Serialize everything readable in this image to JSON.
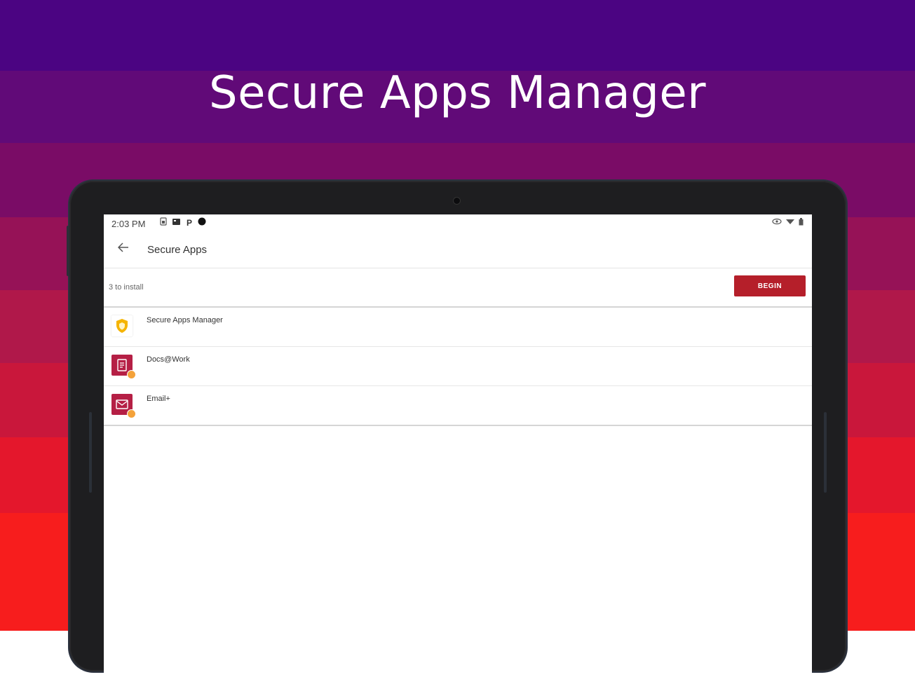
{
  "headline": "Secure Apps Manager",
  "colors": {
    "bands": [
      "#4b0482",
      "#610a78",
      "#7a0c66",
      "#961257",
      "#b0184a",
      "#c9173b",
      "#e4172c",
      "#f71d1d",
      "#fb1a18"
    ],
    "accent": "#b51f2a"
  },
  "status_bar": {
    "time": "2:03 PM",
    "left_icons": [
      "sim-icon",
      "app-notification-icon",
      "parking-icon",
      "record-dot-icon"
    ],
    "p_glyph": "P",
    "right_icons": [
      "eye-icon",
      "wifi-icon",
      "battery-icon"
    ]
  },
  "app_bar": {
    "back_icon": "back-arrow-icon",
    "title": "Secure Apps"
  },
  "install_bar": {
    "count_text": "3 to install",
    "begin_label": "BEGIN"
  },
  "apps": [
    {
      "name": "Secure Apps Manager",
      "icon": "shield-icon"
    },
    {
      "name": "Docs@Work",
      "icon": "document-icon"
    },
    {
      "name": "Email+",
      "icon": "envelope-icon"
    }
  ]
}
